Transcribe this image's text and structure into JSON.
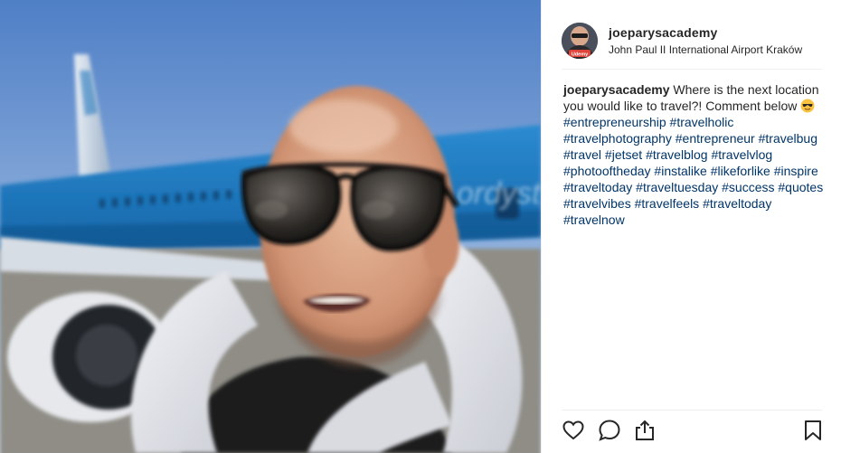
{
  "post": {
    "username": "joeparysacademy",
    "location": "John Paul II International Airport Kraków",
    "avatar_badge": "Udemy",
    "caption": {
      "user": "joeparysacademy",
      "text_before_emoji": "Where is the next location you would like to travel?! Comment below",
      "emoji": "sunglasses-emoji",
      "hashtags": [
        "#entrepreneurship",
        "#travelholic",
        "#travelphotography",
        "#entrepreneur",
        "#travelbug",
        "#travel",
        "#jetset",
        "#travelblog",
        "#travelvlog",
        "#photooftheday",
        "#instalike",
        "#likeforlike",
        "#inspire",
        "#traveltoday",
        "#traveltuesday",
        "#success",
        "#quotes",
        "#travelvibes",
        "#travelfeels",
        "#traveltoday",
        "#travelnow"
      ]
    },
    "actions": [
      "heart-icon",
      "comment-icon",
      "share-icon",
      "bookmark-icon"
    ],
    "photo_text": "ordyst"
  },
  "colors": {
    "text": "#262626",
    "hashtag": "#003569",
    "divider": "#efefef",
    "plane_blue": "#1f7fc4"
  }
}
